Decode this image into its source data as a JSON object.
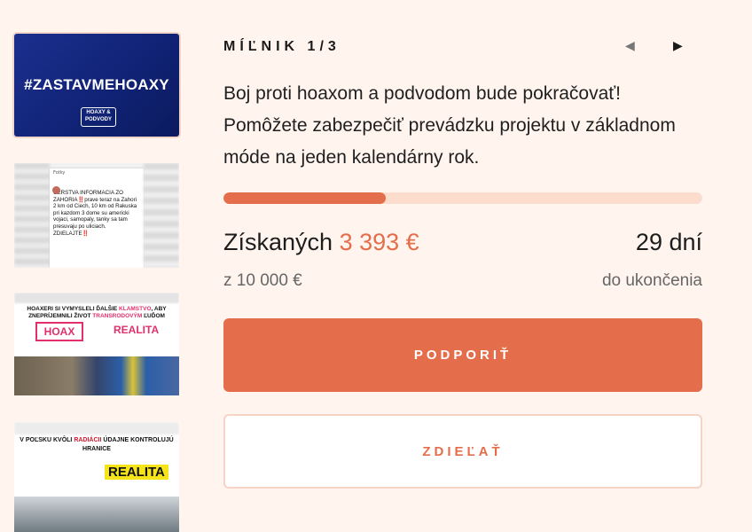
{
  "thumbnails": [
    {
      "tag_prefix": "#ZASTAVME",
      "tag_bold": "HOAXY",
      "badge": "HOAXY & PODVODY"
    },
    {
      "header": "Fotky",
      "post_text": "CERSTVA INFORMACIA ZO ZAHORIA‼️prave teraz na Zahori 2 km od Ciech, 10 km od Rakuska pri kazdom 3 dome su americki vojaci, samopaly, tanky sa tam presuvaju po uliciach. ZDIELAJTE‼️"
    },
    {
      "headline_1": "HOAXERI SI VYMYSLELI ĎALŠIE ",
      "headline_pink": "KLAMSTVO",
      "headline_2": ", ABY ZNEPRÍJEMNILI ŽIVOT ",
      "headline_pink2": "TRANSRODOVÝM",
      "headline_3": " ĽUĎOM",
      "logo": "HOAX",
      "realita": "REALITA"
    },
    {
      "headline_1": "V POĽSKU KVÔLI ",
      "headline_red": "RADIÁCII",
      "headline_2": " ÚDAJNE KONTROLUJÚ HRANICE",
      "realita": "REALITA"
    }
  ],
  "milestone": {
    "label": "MÍĽNIK 1/3"
  },
  "nav": {
    "prev_icon": "◀",
    "next_icon": "▶"
  },
  "description": "Boj proti hoaxom a podvodom bude pokračovať! Pomôžete zabezpečiť prevádzku projektu v základnom móde na jeden kalendárny rok.",
  "progress": {
    "fraction": 0.3393
  },
  "stats": {
    "raised_label": "Získaných",
    "raised_amount": "3 393 €",
    "goal_text": "z  10 000 €",
    "days_text": "29 dní",
    "days_caption": "do ukončenia"
  },
  "buttons": {
    "support": "PODPORIŤ",
    "share": "ZDIEĽAŤ"
  },
  "colors": {
    "accent": "#e46e4b",
    "track": "#fbdccd",
    "background": "#fff5ee"
  }
}
